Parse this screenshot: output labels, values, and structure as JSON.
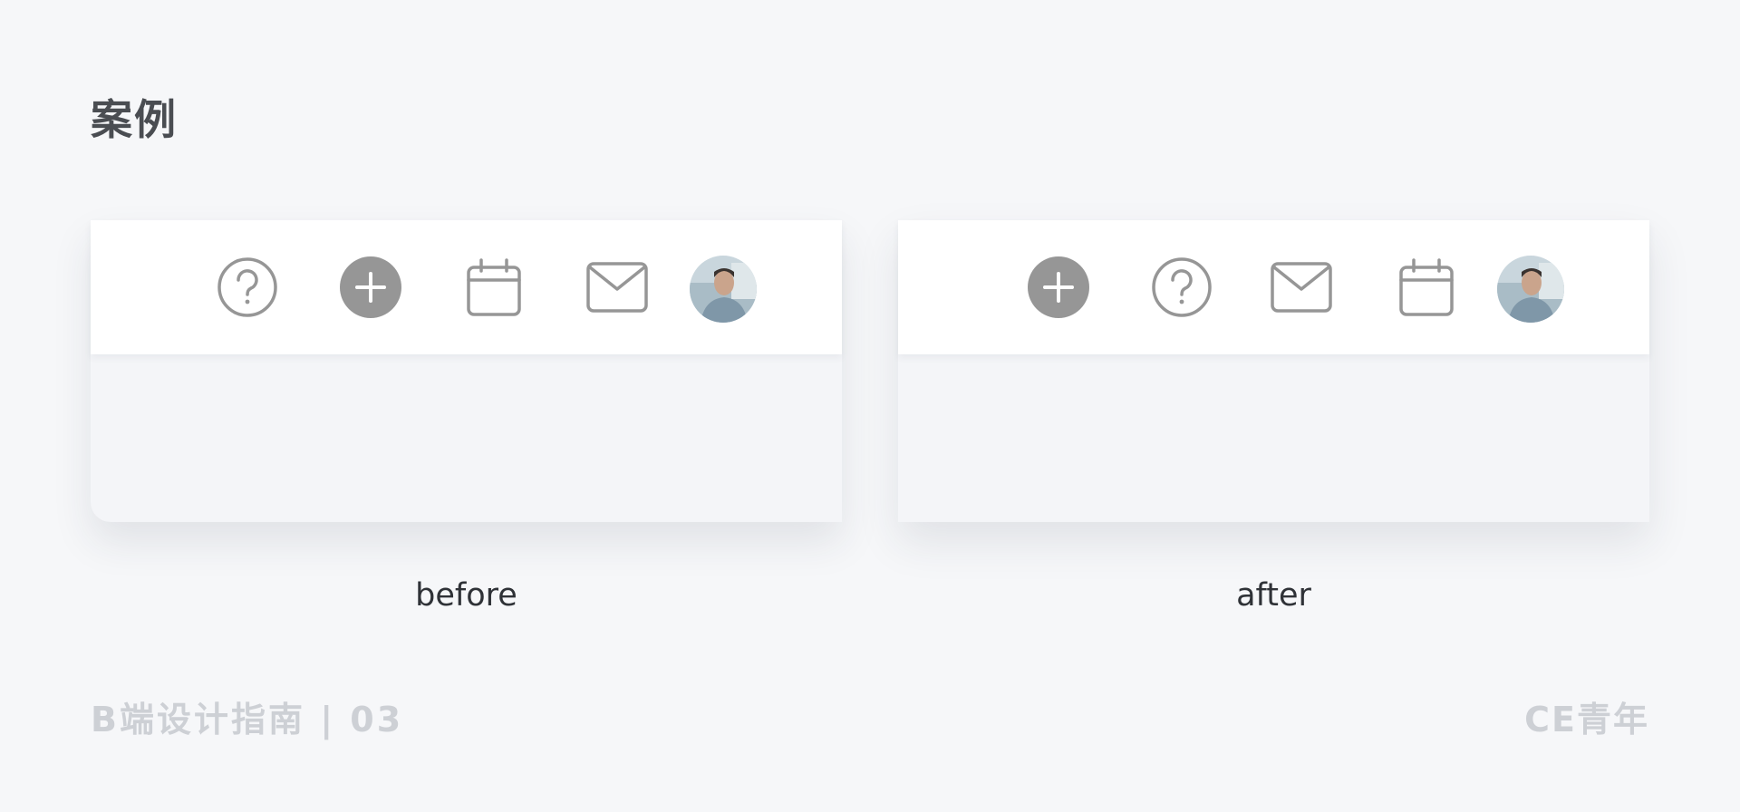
{
  "page": {
    "title": "案例",
    "footer_left": "B端设计指南 | 03",
    "footer_right": "CE青年"
  },
  "cards": {
    "before": {
      "caption": "before",
      "icons": [
        "help-circle-icon",
        "plus-circle-icon",
        "calendar-icon",
        "mail-icon",
        "avatar"
      ]
    },
    "after": {
      "caption": "after",
      "icons": [
        "plus-circle-icon",
        "help-circle-icon",
        "mail-icon",
        "calendar-icon",
        "avatar"
      ]
    }
  },
  "colors": {
    "background": "#f6f7f9",
    "icon_gray": "#969696",
    "title": "#4a4d52",
    "footer": "#cdd0d5"
  }
}
